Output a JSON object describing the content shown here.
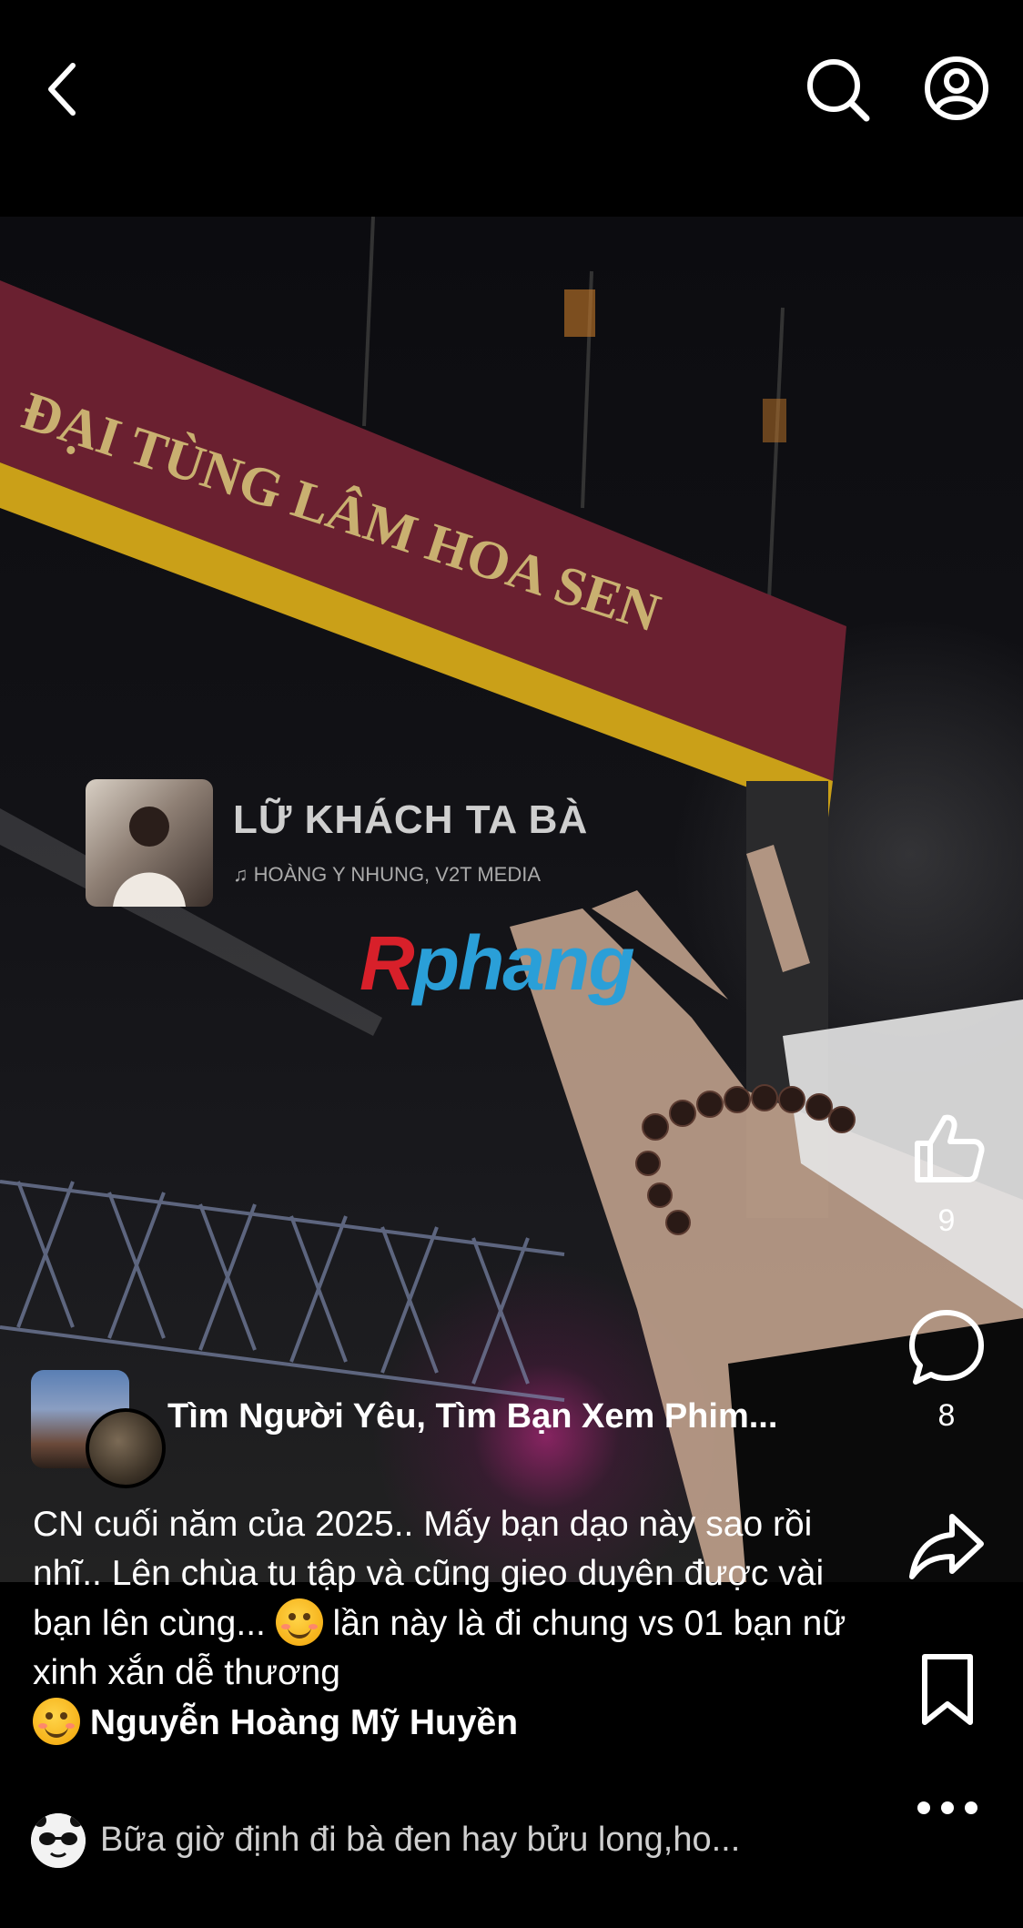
{
  "top_bar": {
    "back_icon": "chevron-left-icon",
    "search_icon": "search-icon",
    "profile_icon": "user-circle-icon"
  },
  "photo": {
    "sign_text": "ĐẠI TÙNG LÂM HOA SEN",
    "watermark_r": "R",
    "watermark_rest": "phang"
  },
  "music": {
    "title": "LỮ KHÁCH TA BÀ",
    "artist": "♫ HOÀNG Y NHUNG, V2T MEDIA"
  },
  "actions": {
    "like_count": "9",
    "comment_count": "8",
    "like_icon": "thumbs-up-icon",
    "comment_icon": "comment-bubble-icon",
    "share_icon": "share-arrow-icon",
    "save_icon": "bookmark-icon",
    "more_icon": "more-dots-icon"
  },
  "author": {
    "group_name": "Tìm Người Yêu, Tìm Bạn Xem Phim..."
  },
  "caption": {
    "part1": "CN cuối năm của 2025.. Mấy bạn dạo này sao rồi nhĩ.. Lên chùa tu tập và cũng gieo duyên được vài bạn lên cùng... ",
    "part2": " lần này là đi chung vs 01 bạn nữ xinh xắn dễ thương ",
    "tagged_user": "Nguyễn Hoàng Mỹ Huyền"
  },
  "comment_preview": {
    "text": "Bữa giờ định đi bà đen hay bửu long,ho..."
  }
}
